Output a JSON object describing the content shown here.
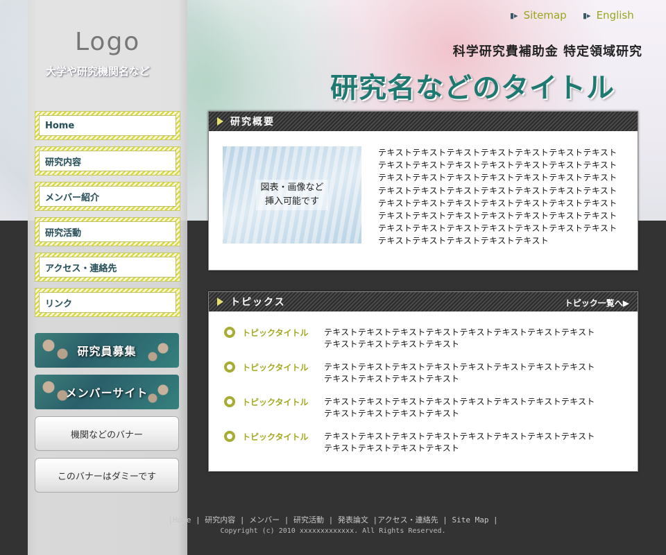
{
  "header": {
    "logo": "Logo",
    "logo_sub": "大学や研究機関名など",
    "top_links": [
      {
        "icon": "bars-icon",
        "label": "Sitemap"
      },
      {
        "icon": "bars-icon",
        "label": "English"
      }
    ],
    "grant": "科学研究費補助金 特定領域研究",
    "title": "研究名などのタイトル"
  },
  "nav": {
    "items": [
      "Home",
      "研究内容",
      "メンバー紹介",
      "研究活動",
      "アクセス・連絡先",
      "リンク"
    ]
  },
  "banners": {
    "recruit": "研究員募集",
    "member_site": "メンバーサイト",
    "banner1": "機関などのバナー",
    "banner2": "このバナーはダミーです"
  },
  "about": {
    "heading": "研究概要",
    "figure_caption_1": "図表・画像など",
    "figure_caption_2": "挿入可能です",
    "text": "テキストテキストテキストテキストテキストテキストテキストテキストテキストテキストテキストテキストテキストテキストテキストテキストテキストテキストテキストテキストテキストテキストテキストテキストテキストテキストテキストテキストテキストテキストテキストテキストテキストテキストテキストテキストテキストテキストテキストテキストテキストテキストテキストテキストテキストテキストテキストテキストテキストテキストテキストテキストテキストテキスト"
  },
  "topics": {
    "heading": "トピックス",
    "more": "トピック一覧へ▶",
    "items": [
      {
        "title": "トピックタイトル",
        "text": "テキストテキストテキストテキストテキストテキストテキストテキストテキストテキストテキストテキスト"
      },
      {
        "title": "トピックタイトル",
        "text": "テキストテキストテキストテキストテキストテキストテキストテキストテキストテキストテキストテキスト"
      },
      {
        "title": "トピックタイトル",
        "text": "テキストテキストテキストテキストテキストテキストテキストテキストテキストテキストテキストテキスト"
      },
      {
        "title": "トピックタイトル",
        "text": "テキストテキストテキストテキストテキストテキストテキストテキストテキストテキストテキストテキスト"
      }
    ]
  },
  "footer": {
    "links": "|Home | 研究内容 | メンバー | 研究活動 | 発表論文 |アクセス・連絡先 | Site Map |",
    "copyright": "Copyright (c) 2010 xxxxxxxxxxxxx. All Rights Reserved."
  }
}
